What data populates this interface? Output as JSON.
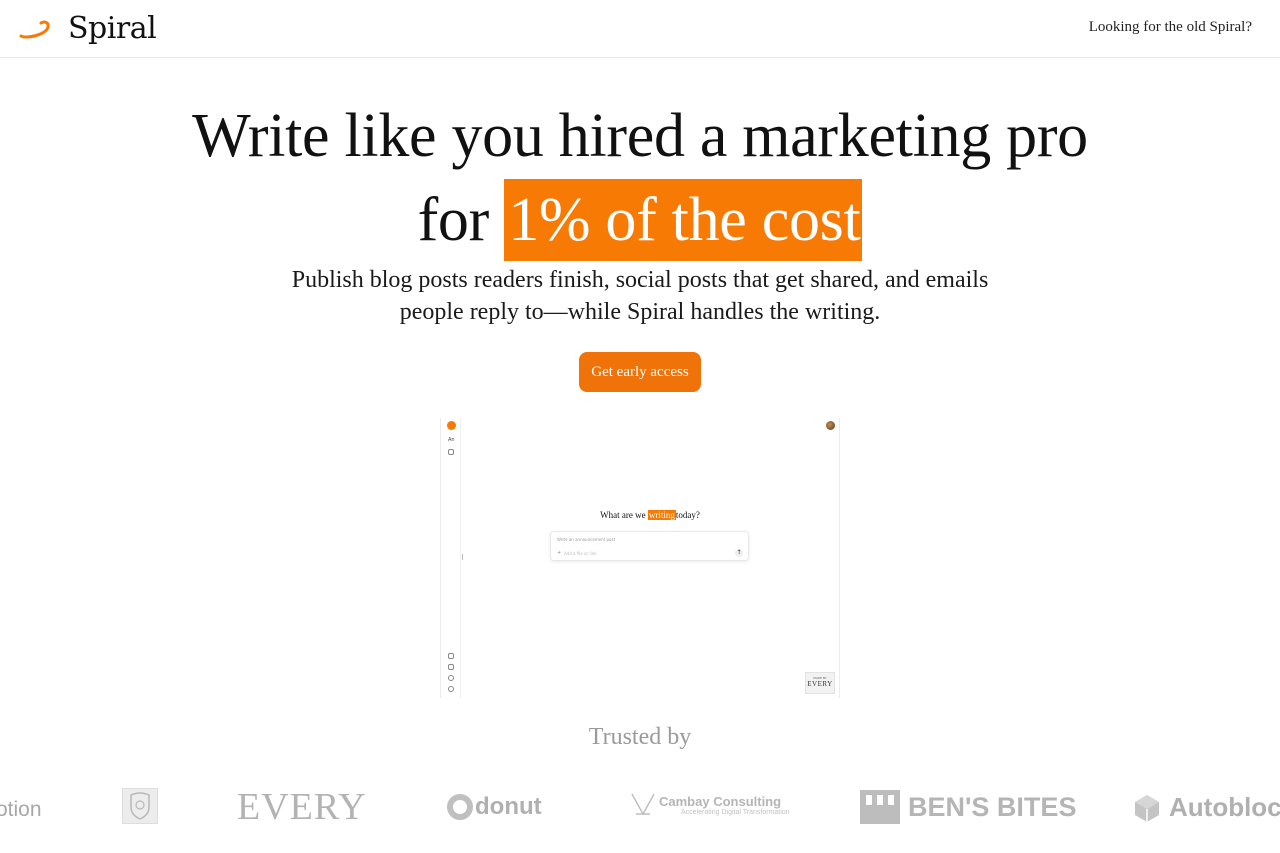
{
  "header": {
    "brand": "Spiral",
    "old_link": "Looking for the old Spiral?"
  },
  "hero": {
    "title_prefix": "Write like you hired a marketing pro",
    "title_for": "for",
    "title_highlight": "1% of the cost",
    "subtitle_line1": "Publish blog posts readers finish, social posts that get shared, and emails",
    "subtitle_line2": "people reply to—while Spiral handles the writing.",
    "cta_label": "Get early access",
    "accent_color": "#f77a05"
  },
  "preview": {
    "sidebar_text": "An",
    "question_before": "What are we",
    "question_highlight": "writing",
    "question_after": "today?",
    "input_placeholder": "Write an announcement post",
    "input_attach_label": "Add a file or link",
    "send_icon": "arrow-up-icon",
    "badge_small": "MADE BY",
    "badge_big": "EVERY"
  },
  "trusted": {
    "heading": "Trusted by",
    "logos": {
      "notion": "otion",
      "every": "EVERY",
      "donut": "donut",
      "cambay": "Cambay Consulting",
      "cambay_tag": "Accelerating Digital Transformation",
      "bens_bites": "BEN'S BITES",
      "autoblocks": "Autoblock"
    }
  }
}
